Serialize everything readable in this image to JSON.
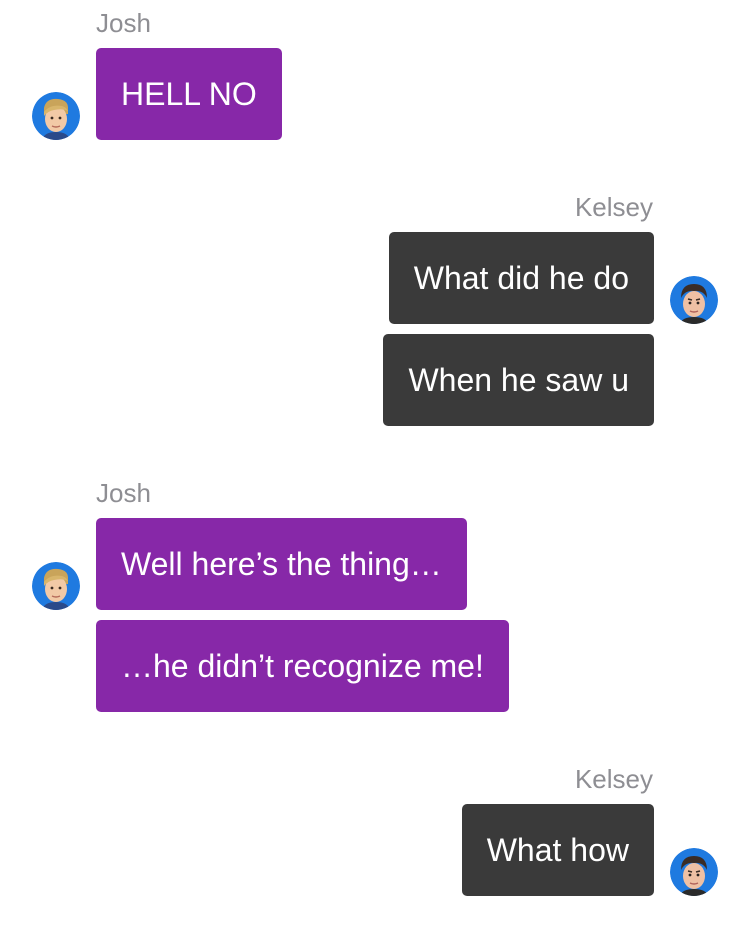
{
  "participants": {
    "josh": {
      "name": "Josh",
      "bubble_color": "#8728a8"
    },
    "kelsey": {
      "name": "Kelsey",
      "bubble_color": "#3a3a3a"
    }
  },
  "messages": [
    {
      "sender": "Josh",
      "text": "HELL NO"
    },
    {
      "sender": "Kelsey",
      "text": "What did he do"
    },
    {
      "sender": "Kelsey",
      "text": "When he saw u"
    },
    {
      "sender": "Josh",
      "text": "Well here’s the thing…"
    },
    {
      "sender": "Josh",
      "text": "…he didn’t recognize me!"
    },
    {
      "sender": "Kelsey",
      "text": "What how"
    }
  ],
  "icons": {
    "josh_avatar": "josh-avatar-icon",
    "kelsey_avatar": "kelsey-avatar-icon"
  }
}
